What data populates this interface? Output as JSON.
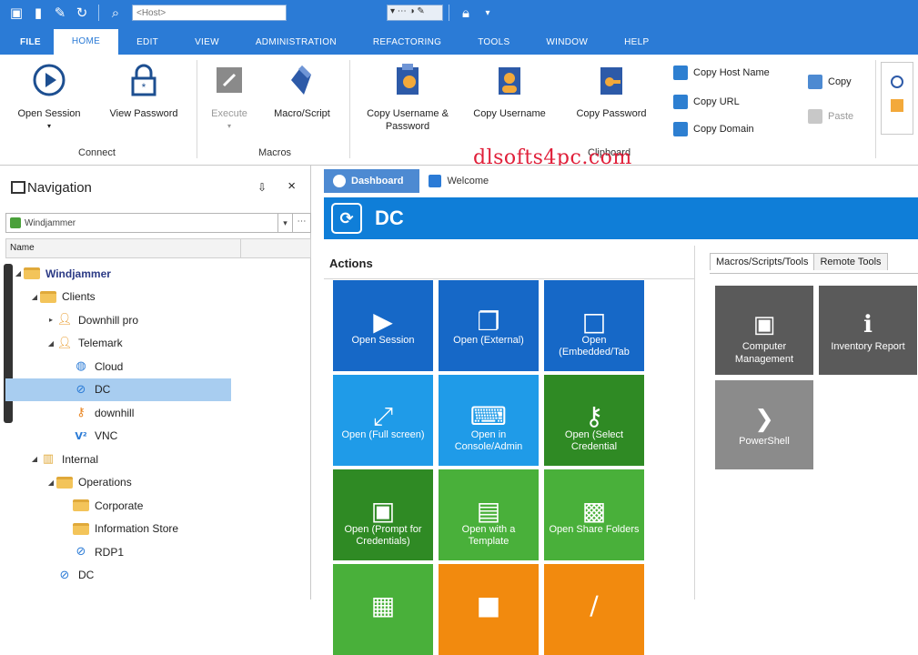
{
  "quick_access": {
    "host_placeholder": "<Host>",
    "icons": [
      "save-icon",
      "new-icon",
      "edit-icon",
      "refresh-icon",
      "search-icon",
      "dropdown-icon",
      "lock-icon"
    ]
  },
  "ribbon_tabs": [
    {
      "label": "FILE"
    },
    {
      "label": "HOME"
    },
    {
      "label": "EDIT"
    },
    {
      "label": "VIEW"
    },
    {
      "label": "ADMINISTRATION"
    },
    {
      "label": "REFACTORING"
    },
    {
      "label": "TOOLS"
    },
    {
      "label": "WINDOW"
    },
    {
      "label": "HELP"
    }
  ],
  "ribbon": {
    "connect": {
      "label": "Connect",
      "open_session": "Open Session",
      "view_password": "View Password"
    },
    "macros": {
      "label": "Macros",
      "execute": "Execute",
      "macro_script": "Macro/Script"
    },
    "clipboard": {
      "label": "Clipboard",
      "copy_user_pass": "Copy Username & Password",
      "copy_username": "Copy Username",
      "copy_password": "Copy Password",
      "copy_host": "Copy Host Name",
      "copy_url": "Copy URL",
      "copy_domain": "Copy Domain",
      "copy": "Copy",
      "paste": "Paste"
    }
  },
  "watermark": "dlsofts4pc.com",
  "navigation": {
    "title": "Navigation",
    "pin": "⇩",
    "close": "×",
    "datasource": "Windjammer",
    "column": "Name",
    "tree": [
      {
        "label": "Windjammer",
        "level": 0,
        "icon": "folder",
        "bold": true,
        "exp": "◢"
      },
      {
        "label": "Clients",
        "level": 1,
        "icon": "folder",
        "exp": "◢"
      },
      {
        "label": "Downhill pro",
        "level": 2,
        "icon": "user",
        "exp": "▸"
      },
      {
        "label": "Telemark",
        "level": 2,
        "icon": "user",
        "exp": "◢"
      },
      {
        "label": "Cloud",
        "level": 3,
        "icon": "globe"
      },
      {
        "label": "DC",
        "level": 3,
        "icon": "rdp",
        "selected": true
      },
      {
        "label": "downhill",
        "level": 3,
        "icon": "key"
      },
      {
        "label": "VNC",
        "level": 3,
        "icon": "vnc"
      },
      {
        "label": "Internal",
        "level": 1,
        "icon": "building",
        "exp": "◢"
      },
      {
        "label": "Operations",
        "level": 2,
        "icon": "folder",
        "exp": "◢"
      },
      {
        "label": "Corporate",
        "level": 3,
        "icon": "folder"
      },
      {
        "label": "Information Store",
        "level": 3,
        "icon": "folder"
      },
      {
        "label": "RDP1",
        "level": 3,
        "icon": "rdp"
      },
      {
        "label": "DC",
        "level": 2,
        "icon": "rdp"
      }
    ]
  },
  "doc_tabs": [
    {
      "label": "Dashboard",
      "active": true
    },
    {
      "label": "Welcome",
      "active": false
    }
  ],
  "entry": {
    "title": "DC",
    "icon": "rdp-icon"
  },
  "actions": {
    "title": "Actions",
    "tiles": [
      {
        "label": "Open Session",
        "color": "#1668c7",
        "glyph": "▶",
        "icon": "play-icon"
      },
      {
        "label": "Open (External)",
        "color": "#1668c7",
        "glyph": "❐",
        "icon": "window-icon"
      },
      {
        "label": "Open (Embedded/Tab",
        "color": "#1668c7",
        "glyph": "□",
        "icon": "tab-window-icon"
      },
      {
        "label": "Open (Full screen)",
        "color": "#1f9be8",
        "glyph": "⤢",
        "icon": "fullscreen-icon"
      },
      {
        "label": "Open in Console/Admin",
        "color": "#1f9be8",
        "glyph": "⌨",
        "icon": "console-icon"
      },
      {
        "label": "Open (Select Credential",
        "color": "#2f8a24",
        "glyph": "⚷",
        "icon": "key-icon"
      },
      {
        "label": "Open (Prompt for Credentials)",
        "color": "#2f8a24",
        "glyph": "▣",
        "icon": "prompt-icon"
      },
      {
        "label": "Open with a Template",
        "color": "#49b03a",
        "glyph": "▤",
        "icon": "template-icon"
      },
      {
        "label": "Open Share Folders",
        "color": "#49b03a",
        "glyph": "▩",
        "icon": "share-folder-icon"
      },
      {
        "label": "",
        "color": "#49b03a",
        "glyph": "▦",
        "icon": "list-icon"
      },
      {
        "label": "",
        "color": "#f28a0e",
        "glyph": "■",
        "icon": "document-icon"
      },
      {
        "label": "",
        "color": "#f28a0e",
        "glyph": "∕",
        "icon": "pen-icon"
      }
    ]
  },
  "side_panel": {
    "tabs": [
      "Macros/Scripts/Tools",
      "Remote Tools"
    ],
    "tiles": [
      {
        "label": "Computer Management",
        "color": "#5a5a5a",
        "glyph": "▣",
        "icon": "computer-management-icon"
      },
      {
        "label": "Inventory Report",
        "color": "#5a5a5a",
        "glyph": "ℹ",
        "icon": "inventory-report-icon"
      },
      {
        "label": "PowerShell",
        "color": "#8b8b8b",
        "glyph": "❯",
        "icon": "powershell-icon"
      }
    ]
  }
}
